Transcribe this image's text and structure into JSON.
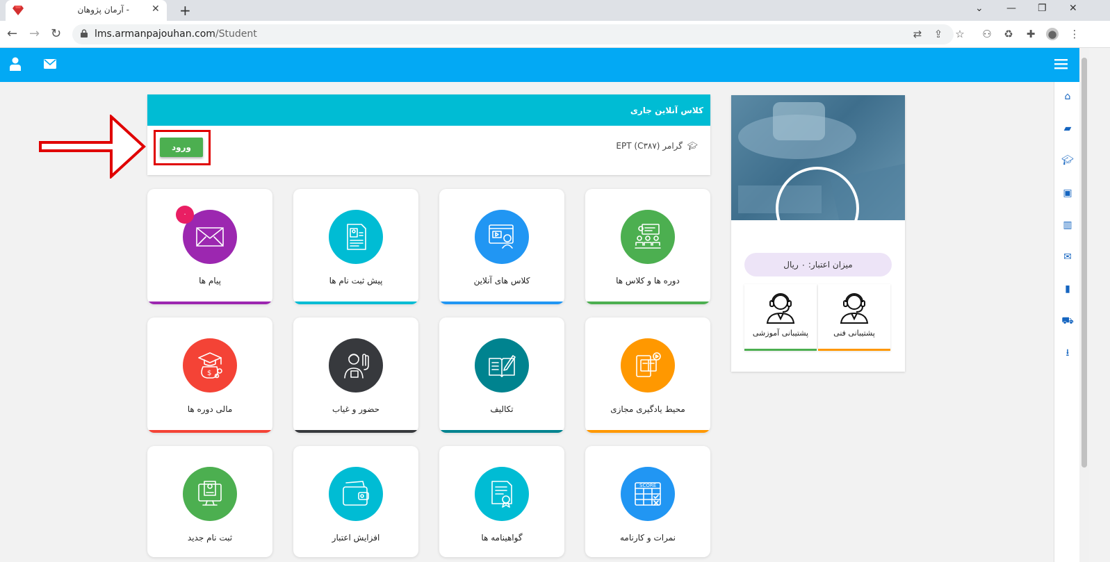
{
  "browser": {
    "tab_title": "- آرمان پژوهان",
    "url_host": "lms.armanpajouhan.com",
    "url_path": "/Student"
  },
  "online_class": {
    "header": "کلاس آنلاین جاری",
    "course_name": "گرامر EPT (C۳۸۷)",
    "enter_label": "ورود"
  },
  "cards": [
    {
      "label": "دوره ها و کلاس ها",
      "color": "#4caf50",
      "icon": "classroom-icon"
    },
    {
      "label": "کلاس های آنلاین",
      "color": "#2196f3",
      "icon": "online-class-icon"
    },
    {
      "label": "پیش ثبت نام ها",
      "color": "#00bcd4",
      "icon": "pre-registration-icon"
    },
    {
      "label": "پیام ها",
      "color": "#9c27b0",
      "icon": "messages-icon",
      "badge": "۰"
    },
    {
      "label": "محیط یادگیری مجازی",
      "color": "#ff9800",
      "icon": "virtual-learning-icon"
    },
    {
      "label": "تکالیف",
      "color": "#00838f",
      "icon": "assignments-icon"
    },
    {
      "label": "حضور و غیاب",
      "color": "#37393d",
      "icon": "attendance-icon"
    },
    {
      "label": "مالی دوره ها",
      "color": "#f44336",
      "icon": "finance-icon"
    },
    {
      "label": "نمرات و کارنامه",
      "color": "#2196f3",
      "icon": "score-icon"
    },
    {
      "label": "گواهینامه ها",
      "color": "#00bcd4",
      "icon": "certificate-icon"
    },
    {
      "label": "افزایش اعتبار",
      "color": "#00bcd4",
      "icon": "wallet-icon"
    },
    {
      "label": "ثبت نام جدید",
      "color": "#4caf50",
      "icon": "new-registration-icon"
    }
  ],
  "profile": {
    "credit": "میزان اعتبار: ۰ ریال",
    "support_technical": "پشتیبانی فنی",
    "support_educational": "پشتیبانی آموزشی"
  },
  "score_icon_text": "SCORE"
}
